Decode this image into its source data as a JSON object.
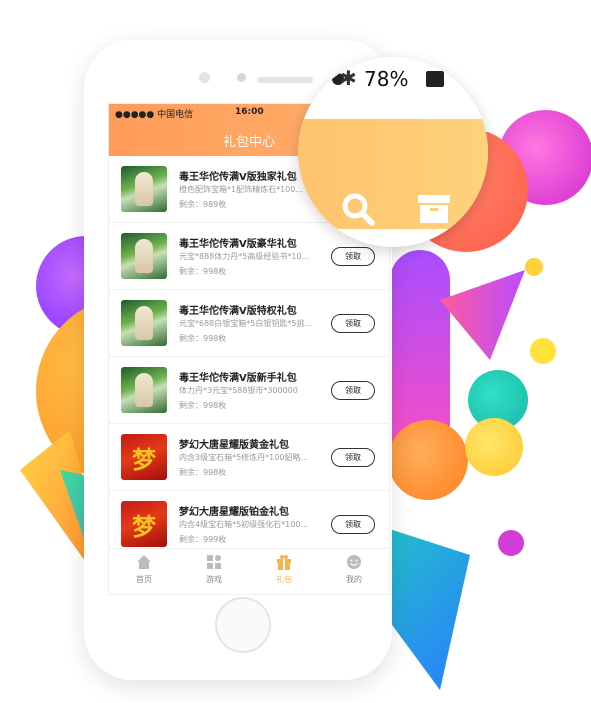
{
  "status_bar": {
    "carrier": "●●●●● 中国电信",
    "time": "16:00",
    "battery_zoom": "78%"
  },
  "nav": {
    "title": "礼包中心"
  },
  "gifts": [
    {
      "title": "毒王华佗传满V版独家礼包",
      "desc": "橙色配饰宝箱*1配饰精炼石*100...",
      "remain": "剩余：989枚",
      "thumb": "type-a",
      "button": "领取"
    },
    {
      "title": "毒王华佗传满V版豪华礼包",
      "desc": "元宝*888体力丹*5高级经验书*10...",
      "remain": "剩余：998枚",
      "thumb": "type-a",
      "button": "领取"
    },
    {
      "title": "毒王华佗传满V版特权礼包",
      "desc": "元宝*688白银宝箱*5白银钥匙*5挑...",
      "remain": "剩余：998枚",
      "thumb": "type-a",
      "button": "领取"
    },
    {
      "title": "毒王华佗传满V版新手礼包",
      "desc": "体力丹*3元宝*588银币*300000",
      "remain": "剩余：998枚",
      "thumb": "type-a",
      "button": "领取"
    },
    {
      "title": "梦幻大唐星耀版黄金礼包",
      "desc": "内含3级宝石箱*5修炼丹*100貂略...",
      "remain": "剩余：998枚",
      "thumb": "type-b",
      "button": "领取"
    },
    {
      "title": "梦幻大唐星耀版铂金礼包",
      "desc": "内含4级宝石箱*5初级强化石*100...",
      "remain": "剩余：999枚",
      "thumb": "type-b",
      "button": "领取"
    }
  ],
  "tabs": [
    {
      "label": "首页",
      "icon": "home-icon"
    },
    {
      "label": "游戏",
      "icon": "grid-icon"
    },
    {
      "label": "礼包",
      "icon": "gift-icon",
      "active": true
    },
    {
      "label": "我的",
      "icon": "smile-icon"
    }
  ],
  "colors": {
    "accent": "#ffa45f",
    "tab_active": "#f7b548"
  }
}
